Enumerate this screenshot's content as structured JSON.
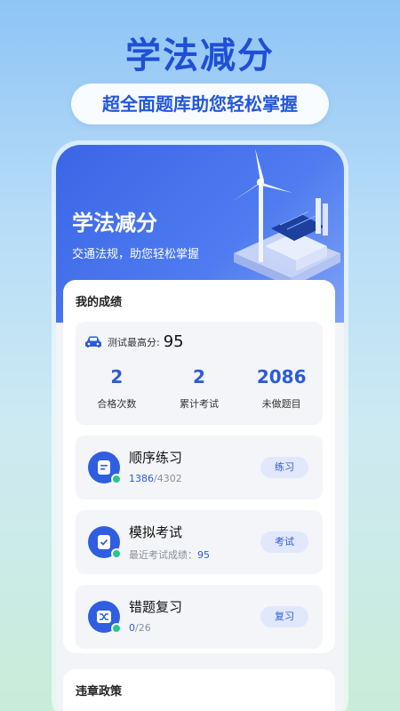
{
  "hero": {
    "title": "学法减分",
    "subtitle": "超全面题库助您轻松掌握"
  },
  "banner": {
    "title": "学法减分",
    "subtitle": "交通法规，助您轻松掌握"
  },
  "scores": {
    "section_title": "我的成绩",
    "best_label": "测试最高分:",
    "best_value": "95",
    "stats": [
      {
        "value": "2",
        "label": "合格次数"
      },
      {
        "value": "2",
        "label": "累计考试"
      },
      {
        "value": "2086",
        "label": "未做题目"
      }
    ]
  },
  "features": [
    {
      "title": "顺序练习",
      "sub_highlight": "1386",
      "sub_rest": "/4302",
      "button": "练习",
      "icon": "document-icon"
    },
    {
      "title": "模拟考试",
      "sub_highlight": "95",
      "sub_prefix": "最近考试成绩：",
      "button": "考试",
      "icon": "exam-check-icon"
    },
    {
      "title": "错题复习",
      "sub_highlight": "0",
      "sub_rest": "/26",
      "button": "复习",
      "icon": "shuffle-icon"
    }
  ],
  "policy": {
    "section_title": "违章政策"
  },
  "colors": {
    "accent": "#2d5bd8",
    "banner": "#3a66e6",
    "badge": "#2bc48a"
  }
}
